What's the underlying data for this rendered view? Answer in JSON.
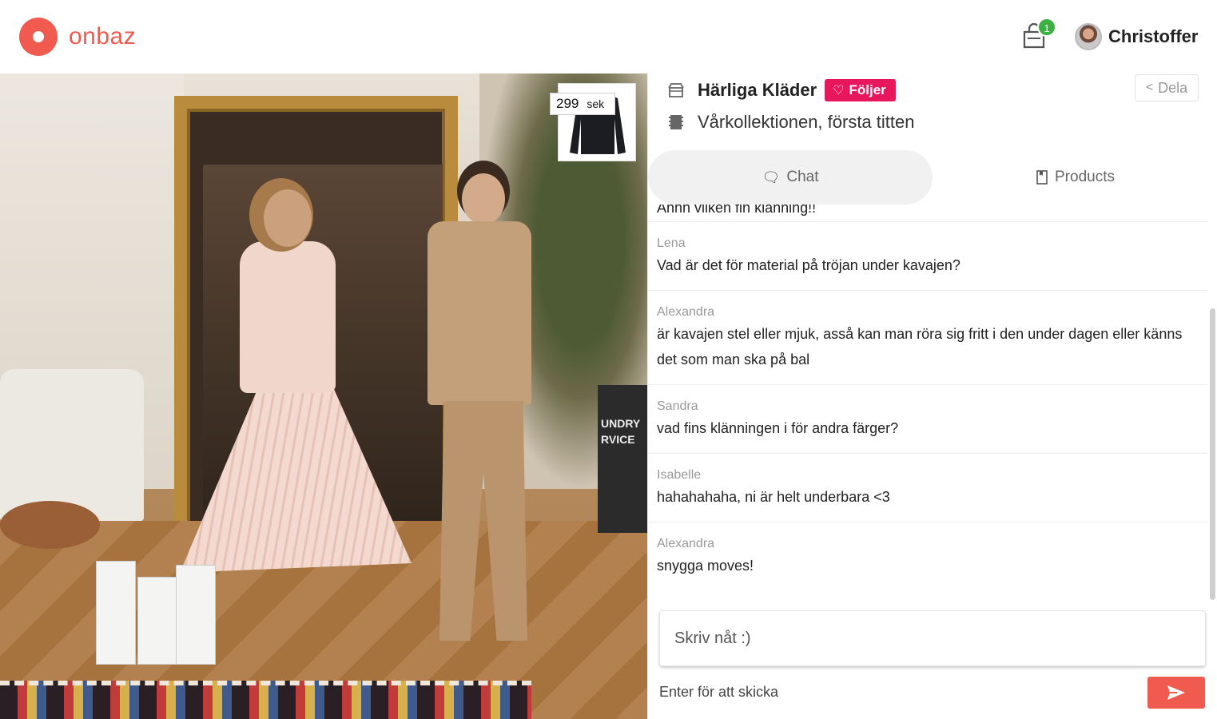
{
  "header": {
    "logo_text": "onbaz",
    "cart_count": "1",
    "user_name": "Christoffer"
  },
  "video": {
    "product_price": "299",
    "product_currency": "sek",
    "laundry_text": "UNDRY RVICE"
  },
  "stream": {
    "store_name": "Härliga Kläder",
    "follow_label": "Följer",
    "title": "Vårkollektionen, första titten",
    "share_label": "Dela"
  },
  "tabs": {
    "chat_label": "Chat",
    "products_label": "Products"
  },
  "chat": {
    "messages": [
      {
        "author": "",
        "text": "Ahhh vilken fin klänning!!"
      },
      {
        "author": "Lena",
        "text": "Vad är det för material på tröjan under kavajen?"
      },
      {
        "author": "Alexandra",
        "text": "är kavajen stel eller mjuk, asså kan man röra sig fritt i den under dagen eller känns det som man ska på bal"
      },
      {
        "author": "Sandra",
        "text": "vad fins klänningen i för andra färger?"
      },
      {
        "author": "Isabelle",
        "text": "hahahahaha, ni är helt underbara <3"
      },
      {
        "author": "Alexandra",
        "text": "snygga moves!"
      }
    ],
    "input_placeholder": "Skriv nåt :)",
    "hint": "Enter för att skicka"
  },
  "colors": {
    "brand": "#f15a4e",
    "follow": "#e8175d",
    "badge": "#3cb043"
  },
  "icons": {
    "cart": "shopping-bag-icon",
    "store": "store-icon",
    "film": "film-icon",
    "share": "share-icon",
    "chat": "chat-bubble-icon",
    "products": "bookmark-icon",
    "send": "send-icon"
  }
}
